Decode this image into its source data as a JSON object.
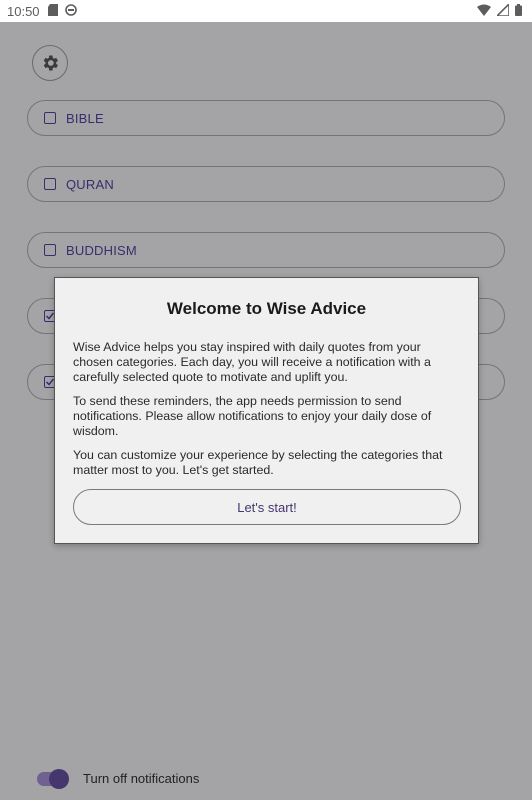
{
  "status_bar": {
    "time": "10:50",
    "left_icons": [
      "sd-card-icon",
      "sync-icon"
    ],
    "right_icons": [
      "wifi-icon",
      "signal-icon",
      "battery-icon"
    ]
  },
  "settings": {
    "icon": "gear-icon"
  },
  "categories": [
    {
      "label": "BIBLE",
      "checked": false
    },
    {
      "label": "QURAN",
      "checked": false
    },
    {
      "label": "BUDDHISM",
      "checked": false
    },
    {
      "label": "",
      "checked": true
    },
    {
      "label": "",
      "checked": true
    }
  ],
  "dialog": {
    "title": "Welcome to Wise Advice",
    "paragraphs": [
      "Wise Advice helps you stay inspired with daily quotes from your chosen categories. Each day, you will receive a notification with a carefully selected quote to motivate and uplift you.",
      "To send these reminders, the app needs permission to send notifications. Please allow notifications to enjoy your daily dose of wisdom.",
      "You can customize your experience by selecting the categories that matter most to you. Let's get started."
    ],
    "button_label": "Let's start!"
  },
  "notifications_toggle": {
    "label": "Turn off notifications",
    "on": true
  },
  "colors": {
    "accent": "#45366e",
    "scrim": "#a4a4a6",
    "dialog_bg": "#f0f0f0"
  }
}
